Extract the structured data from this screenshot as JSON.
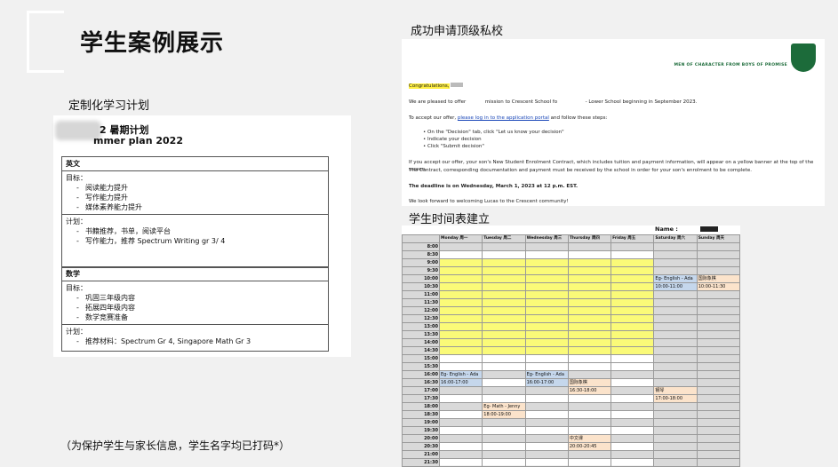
{
  "page": {
    "title": "学生案例展示",
    "plan_label": "定制化学习计划",
    "offer_label": "成功申请顶级私校",
    "timetable_label": "学生时间表建立",
    "footnote": "（为保护学生与家长信息，学生名字均已打码*）"
  },
  "plan": {
    "title_line1": "2 暑期计划",
    "title_line2": "mmer plan 2022",
    "english": {
      "head": "英文",
      "goal_label": "目标：",
      "goals": [
        "阅读能力提升",
        "写作能力提升",
        "媒体素养能力提升"
      ],
      "plan_label": "计划：",
      "plans": [
        "书籍推荐，书单，阅读平台",
        "写作能力，推荐 Spectrum Writing gr 3/ 4"
      ]
    },
    "math": {
      "head": "数学",
      "goal_label": "目标：",
      "goals": [
        "巩固三年级内容",
        "拓展四年级内容",
        "数学竞赛准备"
      ],
      "plan_label": "计划：",
      "plans": [
        "推荐材料：Spectrum Gr 4,    Singapore Math Gr 3"
      ]
    }
  },
  "letter": {
    "motto": "MEN OF CHARACTER FROM BOYS OF PROMISE",
    "congrats": "Congratulations,",
    "p1a": "We are pleased to offer",
    "p1b": "mission to Crescent School fo",
    "p1c": "- Lower School beginning in September 2023.",
    "p2a": "To accept our offer, ",
    "p2link": "please log in to the application portal",
    "p2b": " and follow these steps:",
    "steps": [
      "On the \"Decision\" tab, click \"Let us know your decision\"",
      "Indicate your decision",
      "Click \"Submit decision\""
    ],
    "p3": "If you accept our offer, your son's New Student Enrolment Contract, which includes tuition and payment information, will appear on a yellow banner at the top of the screen.",
    "p3b": "The Contract, corresponding documentation and payment must be received by the school in order for your son's enrolment to be complete.",
    "deadline": "The deadline is on Wednesday, March 1, 2023 at 12 p.m. EST.",
    "closing": "We look forward to welcoming Lucas to the Crescent community!"
  },
  "timetable": {
    "name_label": "Name :",
    "days": [
      "Monday 周一",
      "Tuesday 周二",
      "Wednesday 周三",
      "Thursday 周四",
      "Friday 周五",
      "Saturday 周六",
      "Sunday 周天"
    ],
    "times": [
      "8:00",
      "8:30",
      "9:00",
      "9:30",
      "10:00",
      "10:30",
      "11:00",
      "11:30",
      "12:00",
      "12:30",
      "13:00",
      "13:30",
      "14:00",
      "14:30",
      "15:00",
      "15:30",
      "16:00",
      "16:30",
      "17:00",
      "17:30",
      "18:00",
      "18:30",
      "19:00",
      "19:30",
      "20:00",
      "20:30",
      "21:00",
      "21:30"
    ],
    "events": {
      "sat_1000": "Eg- English - Ada",
      "sat_1030": "10:00-11:00",
      "sun_1000": "国际象棋",
      "sun_1030": "10:00-11:30",
      "mon_1600": "Eg- English - Ada",
      "mon_1630": "16:00-17:00",
      "wed_1600": "Eg- English - Ada",
      "wed_1630": "16:00-17:00",
      "thu_1630": "国际象棋",
      "thu_1700": "16:30-18:00",
      "sat_1700": "钢琴",
      "sat_1730": "17:00-18:00",
      "tue_1800": "Eg- Math - Jenny",
      "tue_1830": "18:00-19:00",
      "thu_2000": "中文课",
      "thu_2030": "20:00-20:45"
    },
    "colors": {
      "school": "#fafa78",
      "weekend": "#d9d9d9",
      "english": "#c5d7ec",
      "activity": "#fbe3cb"
    }
  }
}
